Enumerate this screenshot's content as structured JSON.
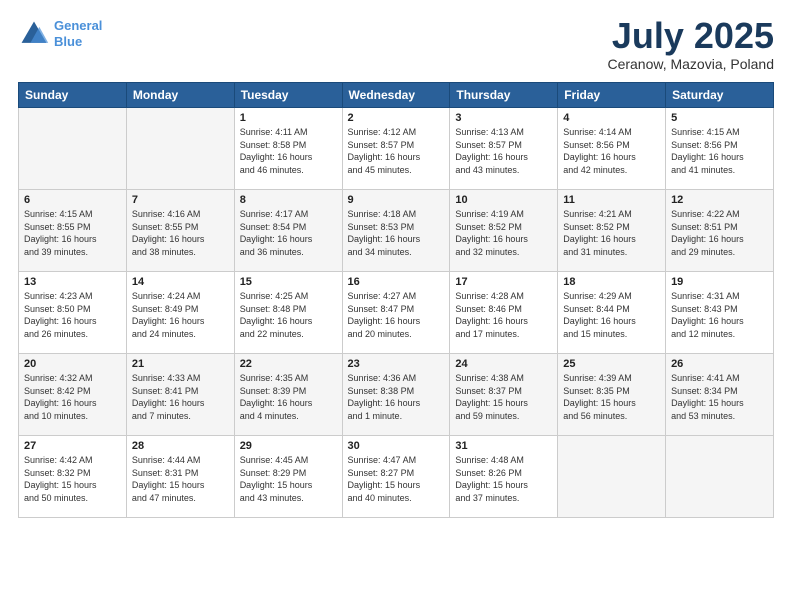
{
  "header": {
    "logo_line1": "General",
    "logo_line2": "Blue",
    "month": "July 2025",
    "location": "Ceranow, Mazovia, Poland"
  },
  "weekdays": [
    "Sunday",
    "Monday",
    "Tuesday",
    "Wednesday",
    "Thursday",
    "Friday",
    "Saturday"
  ],
  "weeks": [
    [
      {
        "day": "",
        "detail": ""
      },
      {
        "day": "",
        "detail": ""
      },
      {
        "day": "1",
        "detail": "Sunrise: 4:11 AM\nSunset: 8:58 PM\nDaylight: 16 hours\nand 46 minutes."
      },
      {
        "day": "2",
        "detail": "Sunrise: 4:12 AM\nSunset: 8:57 PM\nDaylight: 16 hours\nand 45 minutes."
      },
      {
        "day": "3",
        "detail": "Sunrise: 4:13 AM\nSunset: 8:57 PM\nDaylight: 16 hours\nand 43 minutes."
      },
      {
        "day": "4",
        "detail": "Sunrise: 4:14 AM\nSunset: 8:56 PM\nDaylight: 16 hours\nand 42 minutes."
      },
      {
        "day": "5",
        "detail": "Sunrise: 4:15 AM\nSunset: 8:56 PM\nDaylight: 16 hours\nand 41 minutes."
      }
    ],
    [
      {
        "day": "6",
        "detail": "Sunrise: 4:15 AM\nSunset: 8:55 PM\nDaylight: 16 hours\nand 39 minutes."
      },
      {
        "day": "7",
        "detail": "Sunrise: 4:16 AM\nSunset: 8:55 PM\nDaylight: 16 hours\nand 38 minutes."
      },
      {
        "day": "8",
        "detail": "Sunrise: 4:17 AM\nSunset: 8:54 PM\nDaylight: 16 hours\nand 36 minutes."
      },
      {
        "day": "9",
        "detail": "Sunrise: 4:18 AM\nSunset: 8:53 PM\nDaylight: 16 hours\nand 34 minutes."
      },
      {
        "day": "10",
        "detail": "Sunrise: 4:19 AM\nSunset: 8:52 PM\nDaylight: 16 hours\nand 32 minutes."
      },
      {
        "day": "11",
        "detail": "Sunrise: 4:21 AM\nSunset: 8:52 PM\nDaylight: 16 hours\nand 31 minutes."
      },
      {
        "day": "12",
        "detail": "Sunrise: 4:22 AM\nSunset: 8:51 PM\nDaylight: 16 hours\nand 29 minutes."
      }
    ],
    [
      {
        "day": "13",
        "detail": "Sunrise: 4:23 AM\nSunset: 8:50 PM\nDaylight: 16 hours\nand 26 minutes."
      },
      {
        "day": "14",
        "detail": "Sunrise: 4:24 AM\nSunset: 8:49 PM\nDaylight: 16 hours\nand 24 minutes."
      },
      {
        "day": "15",
        "detail": "Sunrise: 4:25 AM\nSunset: 8:48 PM\nDaylight: 16 hours\nand 22 minutes."
      },
      {
        "day": "16",
        "detail": "Sunrise: 4:27 AM\nSunset: 8:47 PM\nDaylight: 16 hours\nand 20 minutes."
      },
      {
        "day": "17",
        "detail": "Sunrise: 4:28 AM\nSunset: 8:46 PM\nDaylight: 16 hours\nand 17 minutes."
      },
      {
        "day": "18",
        "detail": "Sunrise: 4:29 AM\nSunset: 8:44 PM\nDaylight: 16 hours\nand 15 minutes."
      },
      {
        "day": "19",
        "detail": "Sunrise: 4:31 AM\nSunset: 8:43 PM\nDaylight: 16 hours\nand 12 minutes."
      }
    ],
    [
      {
        "day": "20",
        "detail": "Sunrise: 4:32 AM\nSunset: 8:42 PM\nDaylight: 16 hours\nand 10 minutes."
      },
      {
        "day": "21",
        "detail": "Sunrise: 4:33 AM\nSunset: 8:41 PM\nDaylight: 16 hours\nand 7 minutes."
      },
      {
        "day": "22",
        "detail": "Sunrise: 4:35 AM\nSunset: 8:39 PM\nDaylight: 16 hours\nand 4 minutes."
      },
      {
        "day": "23",
        "detail": "Sunrise: 4:36 AM\nSunset: 8:38 PM\nDaylight: 16 hours\nand 1 minute."
      },
      {
        "day": "24",
        "detail": "Sunrise: 4:38 AM\nSunset: 8:37 PM\nDaylight: 15 hours\nand 59 minutes."
      },
      {
        "day": "25",
        "detail": "Sunrise: 4:39 AM\nSunset: 8:35 PM\nDaylight: 15 hours\nand 56 minutes."
      },
      {
        "day": "26",
        "detail": "Sunrise: 4:41 AM\nSunset: 8:34 PM\nDaylight: 15 hours\nand 53 minutes."
      }
    ],
    [
      {
        "day": "27",
        "detail": "Sunrise: 4:42 AM\nSunset: 8:32 PM\nDaylight: 15 hours\nand 50 minutes."
      },
      {
        "day": "28",
        "detail": "Sunrise: 4:44 AM\nSunset: 8:31 PM\nDaylight: 15 hours\nand 47 minutes."
      },
      {
        "day": "29",
        "detail": "Sunrise: 4:45 AM\nSunset: 8:29 PM\nDaylight: 15 hours\nand 43 minutes."
      },
      {
        "day": "30",
        "detail": "Sunrise: 4:47 AM\nSunset: 8:27 PM\nDaylight: 15 hours\nand 40 minutes."
      },
      {
        "day": "31",
        "detail": "Sunrise: 4:48 AM\nSunset: 8:26 PM\nDaylight: 15 hours\nand 37 minutes."
      },
      {
        "day": "",
        "detail": ""
      },
      {
        "day": "",
        "detail": ""
      }
    ]
  ]
}
